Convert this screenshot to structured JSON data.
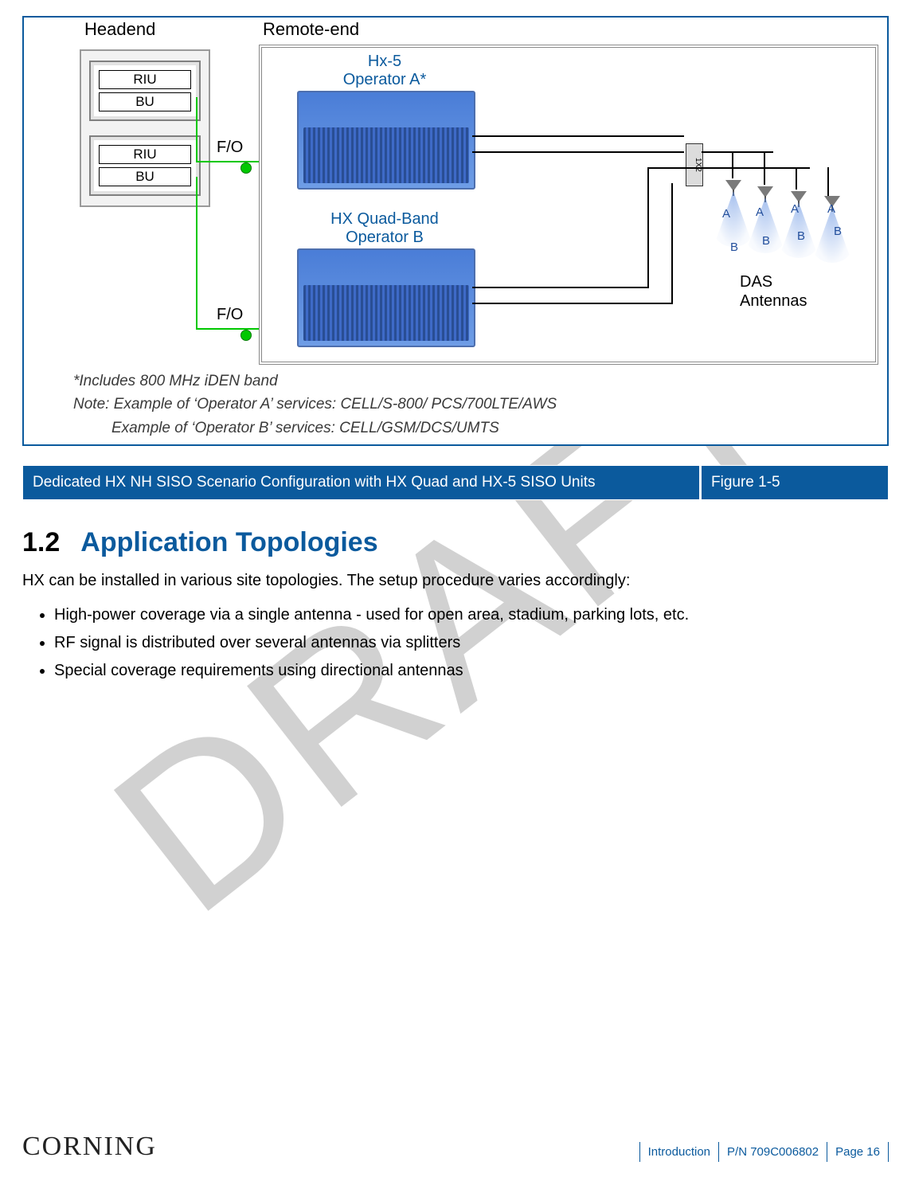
{
  "watermark": "DRAFT",
  "figure": {
    "headend_label": "Headend",
    "remote_label": "Remote-end",
    "riu_groups": [
      {
        "rows": [
          "RIU",
          "BU"
        ]
      },
      {
        "rows": [
          "RIU",
          "BU"
        ]
      }
    ],
    "fo_label_top": "F/O",
    "fo_label_bottom": "F/O",
    "unit_top": {
      "line1": "Hx-5",
      "line2": "Operator A*"
    },
    "unit_bottom": {
      "line1": "HX Quad-Band",
      "line2": "Operator B"
    },
    "splitter": "1X2",
    "das": {
      "line1": "DAS",
      "line2": "Antennas"
    },
    "beam_letters": [
      "A",
      "B",
      "A",
      "B",
      "A",
      "B",
      "A",
      "B"
    ]
  },
  "notes": {
    "n1": "*Includes 800 MHz iDEN band",
    "n2": "Note: Example of ‘Operator A’ services:  CELL/S-800/ PCS/700LTE/AWS",
    "n3": "Example of ‘Operator B’ services:  CELL/GSM/DCS/UMTS"
  },
  "caption": {
    "left": "Dedicated HX NH SISO Scenario Configuration with HX Quad and HX-5 SISO Units",
    "right": "Figure 1-5"
  },
  "section": {
    "number": "1.2",
    "title": "Application Topologies"
  },
  "intro": "HX can be installed in various site topologies. The setup procedure varies accordingly:",
  "bullets": [
    "High-power coverage via a single antenna - used for open area, stadium, parking lots, etc.",
    "RF signal is distributed over several antennas via splitters",
    "Special coverage requirements using directional antennas"
  ],
  "footer": {
    "logo": "CORNING",
    "section": "Introduction",
    "pn": "P/N 709C006802",
    "page": "Page 16"
  }
}
